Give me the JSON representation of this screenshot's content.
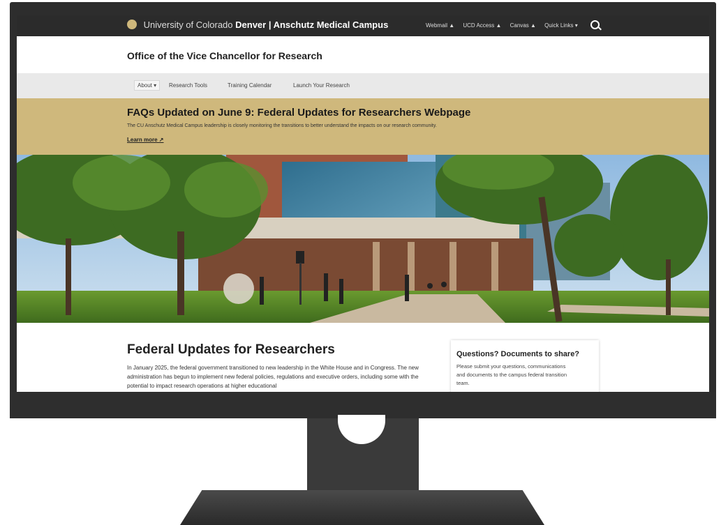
{
  "header": {
    "brand_light": "University of Colorado",
    "brand_bold": "Denver | Anschutz Medical Campus",
    "links": [
      "Webmail ▲",
      "UCD Access ▲",
      "Canvas ▲",
      "Quick Links ▾"
    ]
  },
  "site": {
    "title": "Office of the Vice Chancellor for Research"
  },
  "nav": {
    "items": [
      "About ▾",
      "Research Tools",
      "Training Calendar",
      "Launch Your Research"
    ]
  },
  "alert": {
    "title": "FAQs Updated on June 9: Federal Updates for Researchers Webpage",
    "text": "The CU Anschutz Medical Campus leadership is closely monitoring the transitions to better understand the impacts on our research community.",
    "link": "Learn more ↗"
  },
  "main": {
    "title": "Federal Updates for Researchers",
    "body": "In January 2025, the federal government transitioned to new leadership in the White House and in Congress. The new administration has begun to implement new federal policies, regulations and executive orders, including some with the potential to impact research operations at higher educational"
  },
  "sidebar": {
    "title": "Questions? Documents to share?",
    "text": "Please submit your questions, communications and documents to the campus federal transition team."
  },
  "colors": {
    "gold": "#cfb87c",
    "dark": "#2b2b2b",
    "nav": "#e9e9e9"
  }
}
